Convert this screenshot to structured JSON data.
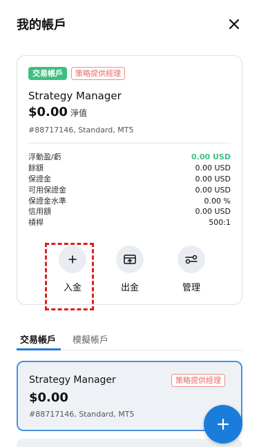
{
  "header": {
    "title": "我的帳戶",
    "close_icon": "close-icon"
  },
  "account_card": {
    "badge_type": "交易帳戶",
    "badge_role": "策略提供經理",
    "name": "Strategy Manager",
    "balance": "$0.00",
    "balance_unit": "淨值",
    "meta": "#88717146, Standard, MT5",
    "stats": [
      {
        "label": "浮動盈/虧",
        "value": "0.00 USD"
      },
      {
        "label": "餘額",
        "value": "0.00 USD"
      },
      {
        "label": "保證金",
        "value": "0.00 USD"
      },
      {
        "label": "可用保證金",
        "value": "0.00 USD"
      },
      {
        "label": "保證金水準",
        "value": "0.00 %"
      },
      {
        "label": "信用額",
        "value": "0.00 USD"
      },
      {
        "label": "槓桿",
        "value": "500:1"
      }
    ],
    "actions": {
      "deposit": "入金",
      "withdraw": "出金",
      "manage": "管理"
    }
  },
  "tabs": {
    "live": "交易帳戶",
    "demo": "模擬帳戶",
    "active": "live"
  },
  "account_list": [
    {
      "name": "Strategy Manager",
      "balance": "$0.00",
      "meta": "#88717146, Standard, MT5",
      "badge": "策略提供經理"
    }
  ],
  "colors": {
    "accent": "#1a7ddb",
    "green": "#3fbf7f",
    "badge_red": "#e86a6a",
    "highlight": "#e01e1e"
  }
}
